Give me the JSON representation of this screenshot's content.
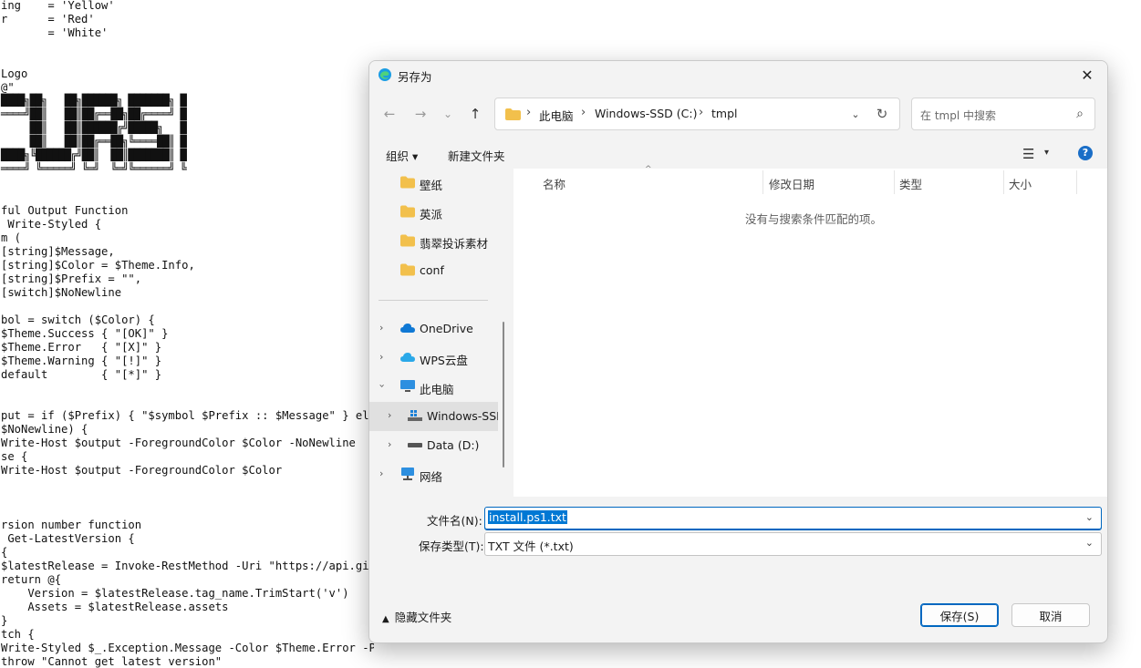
{
  "code_lines": [
    {
      "row": 0,
      "text": "ing    = 'Yellow'"
    },
    {
      "row": 1,
      "text": "r      = 'Red'"
    },
    {
      "row": 2,
      "text": "       = 'White'"
    },
    {
      "row": 5,
      "text": "Logo"
    },
    {
      "row": 6,
      "text": "@\""
    },
    {
      "row": 15,
      "text": "ful Output Function"
    },
    {
      "row": 16,
      "text": " Write-Styled {"
    },
    {
      "row": 17,
      "text": "m ("
    },
    {
      "row": 18,
      "text": "[string]$Message,"
    },
    {
      "row": 19,
      "text": "[string]$Color = $Theme.Info,"
    },
    {
      "row": 20,
      "text": "[string]$Prefix = \"\","
    },
    {
      "row": 21,
      "text": "[switch]$NoNewline"
    },
    {
      "row": 23,
      "text": "bol = switch ($Color) {"
    },
    {
      "row": 24,
      "text": "$Theme.Success { \"[OK]\" }"
    },
    {
      "row": 25,
      "text": "$Theme.Error   { \"[X]\" }"
    },
    {
      "row": 26,
      "text": "$Theme.Warning { \"[!]\" }"
    },
    {
      "row": 27,
      "text": "default        { \"[*]\" }"
    },
    {
      "row": 30,
      "text": "put = if ($Prefix) { \"$symbol $Prefix :: $Message\" } else"
    },
    {
      "row": 31,
      "text": "$NoNewline) {"
    },
    {
      "row": 32,
      "text": "Write-Host $output -ForegroundColor $Color -NoNewline"
    },
    {
      "row": 33,
      "text": "se {"
    },
    {
      "row": 34,
      "text": "Write-Host $output -ForegroundColor $Color"
    },
    {
      "row": 38,
      "text": "rsion number function"
    },
    {
      "row": 39,
      "text": " Get-LatestVersion {"
    },
    {
      "row": 40,
      "text": "{"
    },
    {
      "row": 41,
      "text": "$latestRelease = Invoke-RestMethod -Uri \"https://api.githu"
    },
    {
      "row": 42,
      "text": "return @{"
    },
    {
      "row": 43,
      "text": "    Version = $latestRelease.tag_name.TrimStart('v')"
    },
    {
      "row": 44,
      "text": "    Assets = $latestRelease.assets"
    },
    {
      "row": 45,
      "text": "}"
    },
    {
      "row": 46,
      "text": "tch {"
    },
    {
      "row": 47,
      "text": "Write-Styled $_.Exception.Message -Color $Theme.Error -Prefix \"Error\""
    },
    {
      "row": 48,
      "text": "throw \"Cannot get latest version\""
    }
  ],
  "ascii_art": [
    "████╗██╗   ██╗██████╗ ███████╗ █",
    "════╝██║   ██║██╔══██╗██╔════╝ █",
    "     ██║   ██║██████╔╝█████╗   █",
    "     ██║   ██║██╔══██╗╚════██║ █",
    "████╗╚██████╔╝██║  ██║███████║ █",
    "════╝ ╚═════╝ ╚═╝  ╚═╝╚══════╝ ╚"
  ],
  "dialog": {
    "title": "另存为",
    "close_glyph": "✕",
    "nav": {
      "back": "←",
      "forward": "→",
      "recent": "⌄",
      "up": "↑"
    },
    "address": {
      "crumbs": [
        "此电脑",
        "Windows-SSD (C:)",
        "tmpl"
      ],
      "separator": "›",
      "dropdown_glyph": "⌄",
      "refresh_glyph": "↻"
    },
    "search": {
      "placeholder": "在 tmpl 中搜索",
      "glyph": "⌕"
    },
    "toolbar": {
      "organize": "组织 ▾",
      "new_folder": "新建文件夹",
      "view_glyph": "☰",
      "view_dd": "▾",
      "help": "?"
    },
    "nav_items": {
      "quick": [
        "壁纸",
        "英派",
        "翡翠投诉素材",
        "conf"
      ],
      "onedrive": "OneDrive",
      "wps": "WPS云盘",
      "thispc": "此电脑",
      "cdrive": "Windows-SSD (C:)",
      "ddrive": "Data (D:)",
      "network": "网络"
    },
    "columns": [
      "名称",
      "修改日期",
      "类型",
      "大小"
    ],
    "sort_glyph": "^",
    "empty_message": "没有与搜索条件匹配的项。",
    "filename_label": "文件名(N):",
    "filename_value": "install.ps1.txt",
    "filetype_label": "保存类型(T):",
    "filetype_value": "TXT 文件 (*.txt)",
    "hide_folders": "隐藏文件夹",
    "save": "保存(S)",
    "cancel": "取消",
    "colors": {
      "accent": "#0067c0",
      "selection": "#0078d4",
      "folder": "#f2c04c"
    }
  }
}
